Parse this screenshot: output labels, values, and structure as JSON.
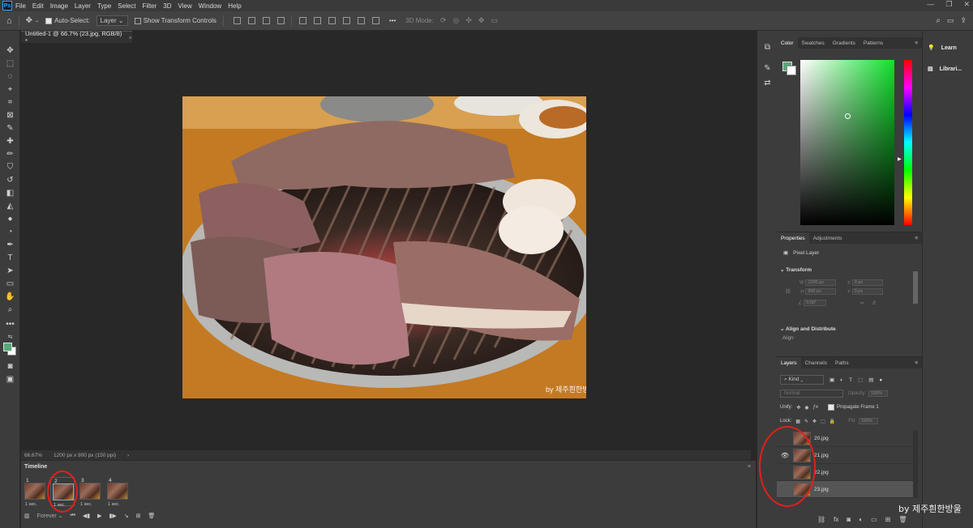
{
  "menu": [
    "File",
    "Edit",
    "Image",
    "Layer",
    "Type",
    "Select",
    "Filter",
    "3D",
    "View",
    "Window",
    "Help"
  ],
  "window_controls": [
    "—",
    "❐",
    "✕"
  ],
  "options_bar": {
    "auto_select_label": "Auto-Select:",
    "auto_select_value": "Layer",
    "show_transform_label": "Show Transform Controls",
    "mode_3d_label": "3D Mode:",
    "more": "•••"
  },
  "document_tab": {
    "title": "Untitled-1 @ 66.7% (23.jpg, RGB/8) *",
    "close": "×"
  },
  "status_bar": {
    "zoom": "66.67%",
    "doc_info": "1200 px x 900 px (150 ppi)",
    "arrow": "›"
  },
  "watermark_photo": "by 제주흰한방울",
  "timeline": {
    "title": "Timeline",
    "frames": [
      {
        "num": "1",
        "dur": "1 sec."
      },
      {
        "num": "2",
        "dur": "1 sec."
      },
      {
        "num": "3",
        "dur": "1 sec."
      },
      {
        "num": "4",
        "dur": "1 sec."
      }
    ],
    "loop": "Forever"
  },
  "color_panel": {
    "tabs": [
      "Color",
      "Swatches",
      "Gradients",
      "Patterns"
    ],
    "fg_color": "#5aa77a",
    "bg_color": "#ffffff"
  },
  "properties_panel": {
    "tabs": [
      "Properties",
      "Adjustments"
    ],
    "layer_type": "Pixel Layer",
    "transform_heading": "Transform",
    "w_label": "W",
    "w_value": "1200 px",
    "h_label": "H",
    "h_value": "900 px",
    "x_label": "X",
    "x_value": "0 px",
    "y_label": "Y",
    "y_value": "0 px",
    "angle_value": "0.00°",
    "align_heading": "Align and Distribute",
    "align_label": "Align:"
  },
  "layers_panel": {
    "tabs": [
      "Layers",
      "Channels",
      "Paths"
    ],
    "kind_label": "Kind",
    "blend_mode": "Normal",
    "opacity_label": "Opacity:",
    "opacity_value": "100%",
    "unify_label": "Unify:",
    "propagate_label": "Propagate Frame 1",
    "lock_label": "Lock:",
    "fill_label": "Fill:",
    "fill_value": "100%",
    "layers": [
      {
        "name": "20.jpg",
        "visible": false
      },
      {
        "name": "21.jpg",
        "visible": true
      },
      {
        "name": "22.jpg",
        "visible": false
      },
      {
        "name": "23.jpg",
        "visible": false
      }
    ],
    "bottom_icons": [
      "link-icon",
      "fx-icon",
      "mask-icon",
      "adjustment-icon",
      "folder-icon",
      "new-layer-icon",
      "trash-icon"
    ]
  },
  "learn_panel": {
    "learn": "Learn",
    "libraries": "Librari..."
  },
  "watermark_screen": "by 제주흰한방울",
  "annotation_color": "#e0201c"
}
